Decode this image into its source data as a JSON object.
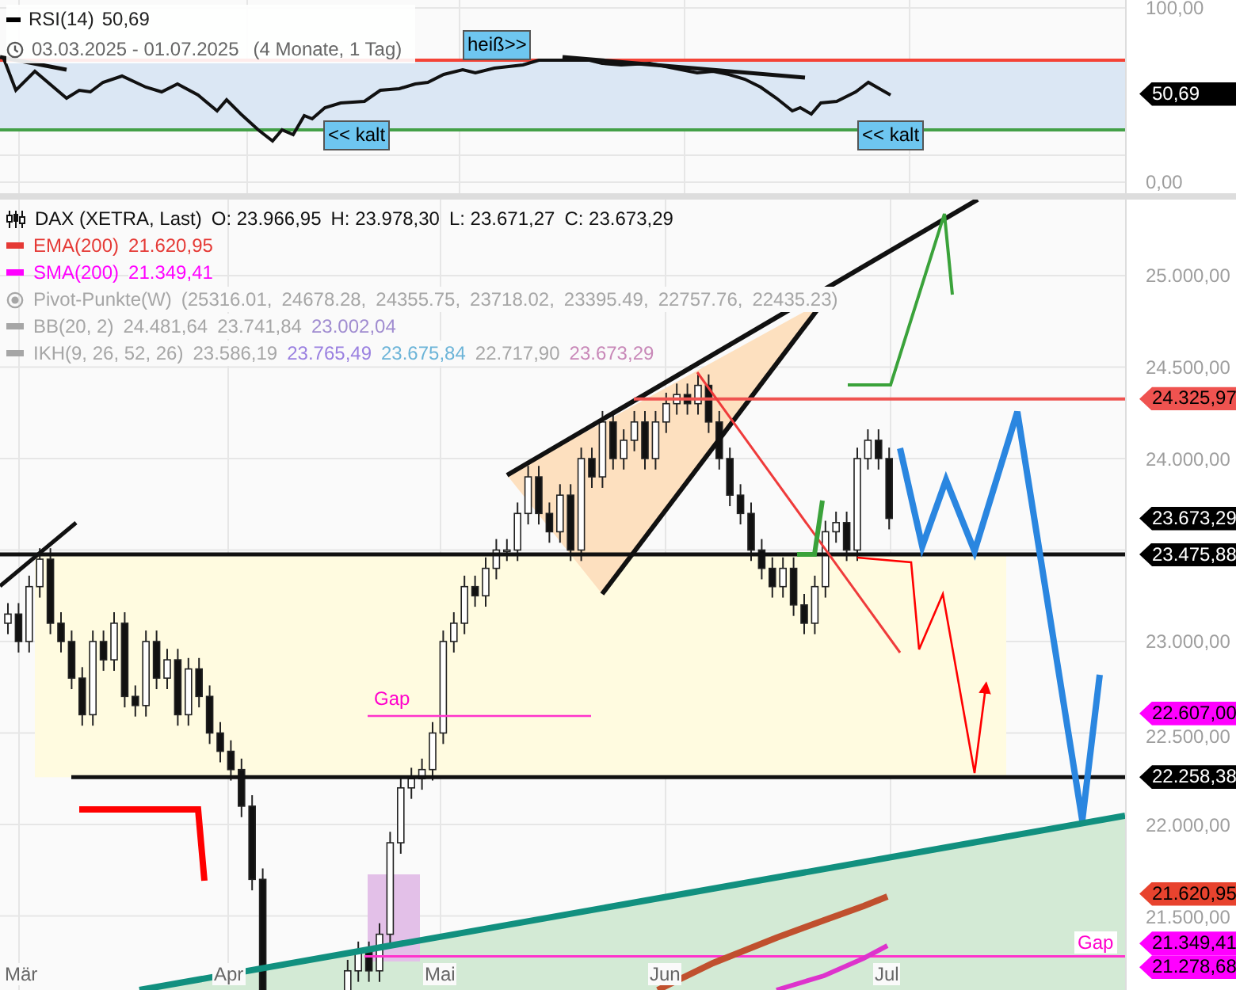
{
  "rsi_panel": {
    "legend": {
      "name": "RSI(14)",
      "value": "50,69"
    },
    "period": {
      "range": "03.03.2025 - 01.07.2025",
      "duration": "(4 Monate, 1 Tag)"
    },
    "tags": [
      {
        "text": "heiß>>",
        "kind": "hot"
      },
      {
        "text": "<< kalt",
        "kind": "cold_left"
      },
      {
        "text": "<< kalt",
        "kind": "cold_right"
      }
    ],
    "axis": [
      {
        "text": "100,00",
        "kind": "tick"
      },
      {
        "text": "50,69",
        "kind": "marker",
        "color": "#000000"
      },
      {
        "text": "0,00",
        "kind": "tick"
      }
    ]
  },
  "price_panel": {
    "legend": {
      "instrument": "DAX (XETRA, Last)",
      "fields": [
        "O: 23.966,95",
        "H: 23.978,30",
        "L: 23.671,27",
        "C: 23.673,29"
      ]
    },
    "indicators": [
      {
        "name": "EMA(200)",
        "kind": "line",
        "color": "#e53935",
        "values": [
          {
            "text": "21.620,95",
            "color": "#e53935"
          }
        ]
      },
      {
        "name": "SMA(200)",
        "kind": "line",
        "color": "#ff00ff",
        "values": [
          {
            "text": "21.349,41",
            "color": "#ff00ff"
          }
        ]
      },
      {
        "name": "Pivot-Punkte(W)",
        "kind": "pivot",
        "color": "#a6a6a6",
        "values": [
          {
            "text": "(25316.01,",
            "color": "#a6a6a6"
          },
          {
            "text": "24678.28,",
            "color": "#a6a6a6"
          },
          {
            "text": "24355.75,",
            "color": "#a6a6a6"
          },
          {
            "text": "23718.02,",
            "color": "#a6a6a6"
          },
          {
            "text": "23395.49,",
            "color": "#a6a6a6"
          },
          {
            "text": "22757.76,",
            "color": "#a6a6a6"
          },
          {
            "text": "22435.23)",
            "color": "#a6a6a6"
          }
        ]
      },
      {
        "name": "BB(20, 2)",
        "kind": "line",
        "color": "#a6a6a6",
        "values": [
          {
            "text": "24.481,64",
            "color": "#a6a6a6"
          },
          {
            "text": "23.741,84",
            "color": "#a6a6a6"
          },
          {
            "text": "23.002,04",
            "color": "#a08cd0"
          }
        ]
      },
      {
        "name": "IKH(9, 26, 52, 26)",
        "kind": "line",
        "color": "#a6a6a6",
        "values": [
          {
            "text": "23.586,19",
            "color": "#a6a6a6"
          },
          {
            "text": "23.765,49",
            "color": "#9a80e0"
          },
          {
            "text": "23.675,84",
            "color": "#6cb4d8"
          },
          {
            "text": "22.717,90",
            "color": "#a6a6a6"
          },
          {
            "text": "23.673,29",
            "color": "#c888b8"
          }
        ]
      }
    ],
    "upper_gap": {
      "label": "Gap"
    },
    "lower_gap": {
      "label": "Gap"
    },
    "x_axis": [
      "Mär",
      "Apr",
      "Mai",
      "Jun",
      "Jul"
    ],
    "axis": [
      {
        "text": "25.000,00",
        "kind": "tick"
      },
      {
        "text": "24.500,00",
        "kind": "tick"
      },
      {
        "text": "24.325,97",
        "kind": "marker",
        "color": "#ef5350"
      },
      {
        "text": "24.000,00",
        "kind": "tick"
      },
      {
        "text": "23.673,29",
        "kind": "marker",
        "color": "#000000"
      },
      {
        "text": "23.475,88",
        "kind": "marker",
        "color": "#000000"
      },
      {
        "text": "23.000,00",
        "kind": "tick"
      },
      {
        "text": "22.607,00",
        "kind": "marker",
        "color": "#ff00ff"
      },
      {
        "text": "22.500,00",
        "kind": "tick"
      },
      {
        "text": "22.258,38",
        "kind": "marker",
        "color": "#000000"
      },
      {
        "text": "22.000,00",
        "kind": "tick"
      },
      {
        "text": "21.620,95",
        "kind": "marker",
        "color": "#e8432e"
      },
      {
        "text": "21.500,00",
        "kind": "tick"
      },
      {
        "text": "21.349,41",
        "kind": "marker",
        "color": "#ff00ff"
      },
      {
        "text": "21.278,68",
        "kind": "marker",
        "color": "#ff00ff"
      }
    ]
  }
}
